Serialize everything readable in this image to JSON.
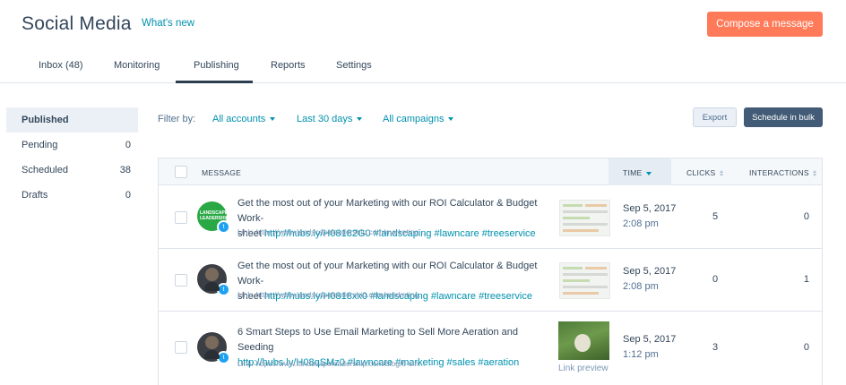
{
  "header": {
    "title": "Social Media",
    "whats_new": "What's new",
    "compose_label": "Compose a message"
  },
  "tabs": [
    {
      "label": "Inbox (48)"
    },
    {
      "label": "Monitoring"
    },
    {
      "label": "Publishing",
      "active": true
    },
    {
      "label": "Reports"
    },
    {
      "label": "Settings"
    }
  ],
  "sidebar": {
    "items": [
      {
        "label": "Published",
        "count": "",
        "active": true
      },
      {
        "label": "Pending",
        "count": "0"
      },
      {
        "label": "Scheduled",
        "count": "38"
      },
      {
        "label": "Drafts",
        "count": "0"
      }
    ]
  },
  "filters": {
    "label": "Filter by:",
    "accounts": "All accounts",
    "period": "Last 30 days",
    "campaigns": "All campaigns"
  },
  "actions": {
    "export_label": "Export",
    "bulk_label": "Schedule in bulk"
  },
  "table": {
    "columns": {
      "message": "MESSAGE",
      "time": "TIME",
      "clicks": "CLICKS",
      "interactions": "INTERACTIONS"
    },
    "rows": [
      {
        "avatar": "landscape-leadership-logo",
        "avatar_text": "LANDSCAPE LEADERSHIP",
        "network": "twitter",
        "text_line1": "Get the most out of your Marketing with our ROI Calculator & Budget Work-",
        "text_line2_prefix": "sheet",
        "link_text": "http://hubs.ly/H08182G0 #landscaping #lawncare #treeservice",
        "preview_url": "Link: https://www.landscapeleadership.com/marketing...",
        "date": "Sep 5, 2017",
        "time": "2:08 pm",
        "clicks": "5",
        "interactions": "0"
      },
      {
        "avatar": "person-avatar",
        "network": "twitter",
        "text_line1": "Get the most out of your Marketing with our ROI Calculator & Budget Work-",
        "text_line2_prefix": "sheet",
        "link_text": "http://hubs.ly/H0818xx0 #landscaping #lawncare #treeservice",
        "preview_url": "Link: https://www.landscapeleadership.com/marketing...",
        "date": "Sep 5, 2017",
        "time": "2:08 pm",
        "clicks": "0",
        "interactions": "1"
      },
      {
        "avatar": "person-avatar",
        "network": "twitter",
        "text_line1": "6 Smart Steps to Use Email Marketing to Sell More Aeration and Seeding",
        "text_line2_prefix": "",
        "link_text": "http://hubs.ly/H08qSMz0 #lawncare #marketing #sales #aeration",
        "preview_url": "Link: https://www.landscapeleadership.com/blog/6-sm...",
        "thumb_caption": "Link preview",
        "date": "Sep 5, 2017",
        "time": "1:12 pm",
        "clicks": "3",
        "interactions": "0"
      }
    ]
  },
  "colors": {
    "accent_orange": "#ff7a59",
    "link_teal": "#0091ae",
    "dark_slate": "#425b76",
    "twitter_blue": "#1da1f2"
  }
}
